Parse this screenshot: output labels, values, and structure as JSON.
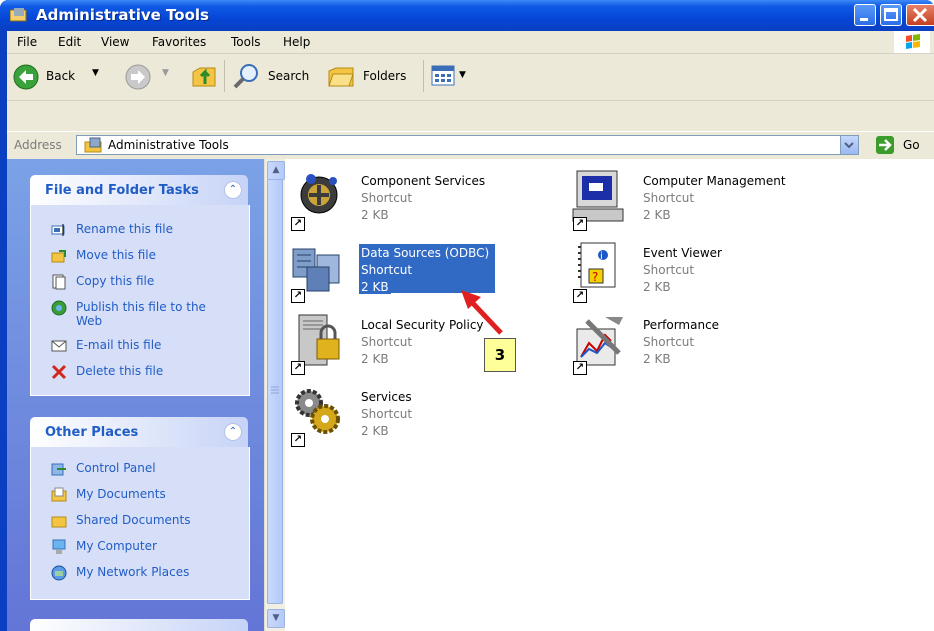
{
  "window": {
    "title": "Administrative Tools",
    "colors": {
      "titlebar": "#0546d6",
      "panel": "#ece9d8",
      "link": "#215dc6",
      "selection": "#316ac5",
      "callout": "#ffff99",
      "arrow": "#e02020"
    }
  },
  "menu": [
    "File",
    "Edit",
    "View",
    "Favorites",
    "Tools",
    "Help"
  ],
  "toolbar": {
    "back_label": "Back",
    "search_label": "Search",
    "folders_label": "Folders"
  },
  "address": {
    "label": "Address",
    "value": "Administrative Tools",
    "go_label": "Go"
  },
  "tasks": {
    "file_folder": {
      "title": "File and Folder Tasks",
      "items": [
        {
          "label": "Rename this file",
          "icon": "rename-icon"
        },
        {
          "label": "Move this file",
          "icon": "move-icon"
        },
        {
          "label": "Copy this file",
          "icon": "copy-icon"
        },
        {
          "label": "Publish this file to the",
          "label2": "Web",
          "icon": "publish-icon"
        },
        {
          "label": "E-mail this file",
          "icon": "email-icon"
        },
        {
          "label": "Delete this file",
          "icon": "delete-icon"
        }
      ]
    },
    "other_places": {
      "title": "Other Places",
      "items": [
        {
          "label": "Control Panel",
          "icon": "control-panel-icon"
        },
        {
          "label": "My Documents",
          "icon": "my-documents-icon"
        },
        {
          "label": "Shared Documents",
          "icon": "shared-documents-icon"
        },
        {
          "label": "My Computer",
          "icon": "my-computer-icon"
        },
        {
          "label": "My Network Places",
          "icon": "network-places-icon"
        }
      ]
    }
  },
  "files": [
    {
      "name": "Component Services",
      "type": "Shortcut",
      "size": "2 KB",
      "icon": "component-services-icon"
    },
    {
      "name": "Computer Management",
      "type": "Shortcut",
      "size": "2 KB",
      "icon": "computer-management-icon"
    },
    {
      "name": "Data Sources (ODBC)",
      "type": "Shortcut",
      "size": "2 KB",
      "icon": "data-sources-icon",
      "selected": true
    },
    {
      "name": "Event Viewer",
      "type": "Shortcut",
      "size": "2 KB",
      "icon": "event-viewer-icon"
    },
    {
      "name": "Local Security Policy",
      "type": "Shortcut",
      "size": "2 KB",
      "icon": "local-security-policy-icon"
    },
    {
      "name": "Performance",
      "type": "Shortcut",
      "size": "2 KB",
      "icon": "performance-icon"
    },
    {
      "name": "Services",
      "type": "Shortcut",
      "size": "2 KB",
      "icon": "services-icon"
    }
  ],
  "callout": {
    "number": "3"
  }
}
